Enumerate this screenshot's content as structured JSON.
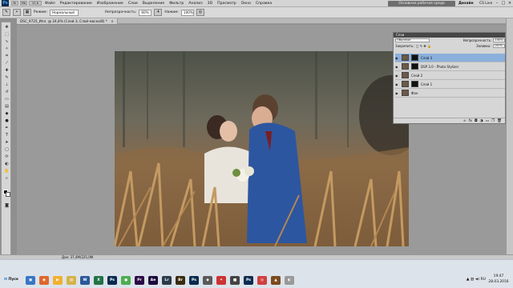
{
  "menubar": {
    "logo": "Ps",
    "items": [
      "Файл",
      "Редактирование",
      "Изображение",
      "Слои",
      "Выделение",
      "Фильтр",
      "Анализ",
      "3D",
      "Просмотр",
      "Окно",
      "Справка"
    ],
    "mini_zoom": "25,6"
  },
  "workspace": {
    "label": "Основная рабочая среда",
    "design": "Дизайн",
    "cslive": "CS Live"
  },
  "window_buttons": [
    "–",
    "□",
    "×"
  ],
  "options": {
    "mode_label": "Режим:",
    "mode_value": "Нормальный",
    "opacity_label": "Непрозрачность:",
    "opacity_value": "60%",
    "flow_label": "Нажим:",
    "flow_value": "100%"
  },
  "document": {
    "tab_title": "DSC_9725_Ипл. @ 24,8% (Слой 3, Слой-маска/8) *",
    "close": "×"
  },
  "status": {
    "text": "Док: 37,4M/225,0M"
  },
  "layers_panel": {
    "title": "Слои",
    "blend_mode": "Обычные",
    "opacity_label": "Непрозрачность:",
    "opacity_value": "100%",
    "lock_label": "Закрепить:",
    "fill_label": "Заливка:",
    "fill_value": "100%",
    "layers": [
      {
        "name": "Слой 3",
        "selected": true,
        "has_mask": true
      },
      {
        "name": "DSP 3.0 - Photo Stylizer",
        "selected": false,
        "has_mask": true
      },
      {
        "name": "Слой 2",
        "selected": false,
        "has_mask": false
      },
      {
        "name": "Слой 1",
        "selected": false,
        "has_mask": true
      },
      {
        "name": "Фон",
        "selected": false,
        "has_mask": false
      }
    ]
  },
  "taskbar": {
    "start_label": "Пуск",
    "apps": [
      {
        "name": "explorer",
        "glyph": "▣",
        "color": "#3a76c4"
      },
      {
        "name": "firefox",
        "glyph": "◉",
        "color": "#e0662a"
      },
      {
        "name": "media",
        "glyph": "▶",
        "color": "#f0b030"
      },
      {
        "name": "folder",
        "glyph": "▤",
        "color": "#d5b24a"
      },
      {
        "name": "word",
        "glyph": "W",
        "color": "#2b579a"
      },
      {
        "name": "excel",
        "glyph": "X",
        "color": "#217346"
      },
      {
        "name": "photoshop",
        "glyph": "Ps",
        "color": "#0a2b4f"
      },
      {
        "name": "chrome",
        "glyph": "●",
        "color": "#4caf50"
      },
      {
        "name": "premiere",
        "glyph": "Pr",
        "color": "#2a0845"
      },
      {
        "name": "aftereffects",
        "glyph": "Ae",
        "color": "#1a0b3d"
      },
      {
        "name": "lightroom",
        "glyph": "Lr",
        "color": "#2b3a4a"
      },
      {
        "name": "bridge",
        "glyph": "Br",
        "color": "#3a2b10"
      },
      {
        "name": "photoshop2",
        "glyph": "Ps",
        "color": "#0a2b4f"
      },
      {
        "name": "app",
        "glyph": "◆",
        "color": "#5a5a5a"
      },
      {
        "name": "app2",
        "glyph": "✦",
        "color": "#cc3333"
      },
      {
        "name": "app3",
        "glyph": "■",
        "color": "#444"
      },
      {
        "name": "photoshop3",
        "glyph": "Ps",
        "color": "#0a2b4f"
      },
      {
        "name": "app4",
        "glyph": "◎",
        "color": "#d04040"
      },
      {
        "name": "app5",
        "glyph": "▲",
        "color": "#7a4a20"
      },
      {
        "name": "app6",
        "glyph": "◐",
        "color": "#999"
      }
    ],
    "tray_lang": "RU",
    "time": "19:47",
    "date": "28.03.2016"
  }
}
